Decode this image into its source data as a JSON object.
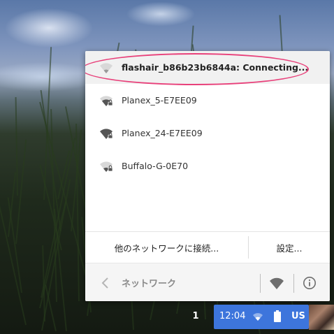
{
  "network_popup": {
    "networks": [
      {
        "name": "flashair_b86b23b6844a: Connecting...",
        "signal": "weak",
        "secured": false,
        "state": "connecting"
      },
      {
        "name": "Planex_5-E7EE09",
        "signal": "medium",
        "secured": true,
        "state": "available"
      },
      {
        "name": "Planex_24-E7EE09",
        "signal": "full",
        "secured": true,
        "state": "available"
      },
      {
        "name": "Buffalo-G-0E70",
        "signal": "weak",
        "secured": true,
        "state": "available"
      }
    ],
    "connect_other_label": "他のネットワークに接続...",
    "settings_label": "設定...",
    "header": {
      "back_icon": "chevron-left-icon",
      "title": "ネットワーク",
      "wifi_toggle_icon": "wifi-icon",
      "info_icon": "info-icon"
    },
    "highlight_color": "#e8407a"
  },
  "shelf": {
    "notification_count": "1",
    "status": {
      "time": "12:04",
      "ime": "US",
      "accent": "#3d75dc"
    }
  }
}
